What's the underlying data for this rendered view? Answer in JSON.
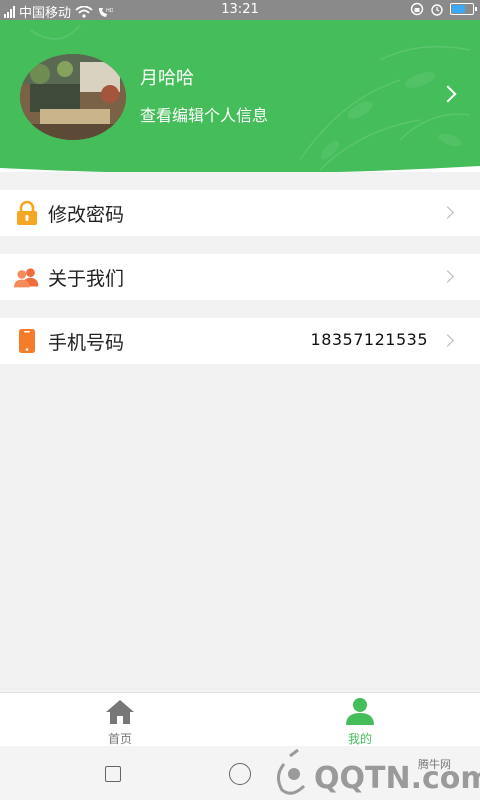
{
  "status_bar": {
    "carrier": "中国移动",
    "time": "13:21"
  },
  "profile": {
    "name": "月哈哈",
    "subtitle": "查看编辑个人信息"
  },
  "settings": [
    {
      "label": "修改密码",
      "icon": "lock-icon",
      "value": ""
    },
    {
      "label": "关于我们",
      "icon": "people-icon",
      "value": ""
    },
    {
      "label": "手机号码",
      "icon": "phone-icon",
      "value": "18357121535"
    }
  ],
  "tabbar": {
    "home_label": "首页",
    "mine_label": "我的"
  },
  "watermark": {
    "text": "QQTN.com",
    "label": "腾牛网"
  },
  "colors": {
    "brand_green": "#45bd5a",
    "lock_orange": "#f5a623",
    "people_orange": "#f26b3a",
    "phone_orange": "#f57c2a",
    "tab_inactive": "#777777"
  }
}
